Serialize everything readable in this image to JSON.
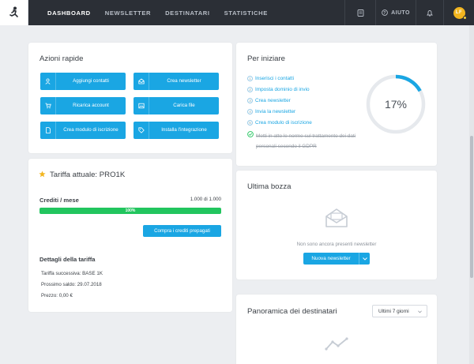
{
  "nav": {
    "items": [
      "DASHBOARD",
      "NEWSLETTER",
      "DESTINATARI",
      "STATISTICHE"
    ],
    "help_label": "AIUTO",
    "avatar_initials": "LF"
  },
  "quick_actions": {
    "title": "Azioni rapide",
    "buttons": [
      "Aggiungi contatti",
      "Crea newsletter",
      "Ricarica account",
      "Carica file",
      "Crea modulo di iscrizione",
      "Installa l'integrazione"
    ]
  },
  "getting_started": {
    "title": "Per iniziare",
    "steps": [
      "Inserisci i contatti",
      "Imposta dominio di invio",
      "Crea newsletter",
      "Invia la newsletter",
      "Crea modulo di iscrizione",
      "Metti in atto le norme sul trattamento dei dati personali secondo il GDPR"
    ],
    "progress_label": "17%",
    "progress": 0.17
  },
  "plan": {
    "title": "Tariffa attuale: PRO1K",
    "credits_label": "Crediti / mese",
    "credits_value": "1.000 di 1.000",
    "bar_label": "100%",
    "bar_fill": 1.0,
    "buy_button": "Compra i crediti prepagati",
    "details_title": "Dettagli della tariffa",
    "next_plan": "Tariffa successiva: BASE 1K",
    "next_payment": "Prossimo saldo: 29.07.2018",
    "price": "Prezzo: 0,00 €"
  },
  "draft": {
    "title": "Ultima bozza",
    "empty_text": "Non sono ancora presenti newsletter",
    "new_button": "Nuova newsletter"
  },
  "recipients": {
    "title": "Panoramica dei destinatari",
    "range_select": "Ultimi 7 giorni"
  },
  "colors": {
    "accent": "#1aa6e3",
    "green": "#22c55e",
    "topbar": "#2b2f36"
  }
}
